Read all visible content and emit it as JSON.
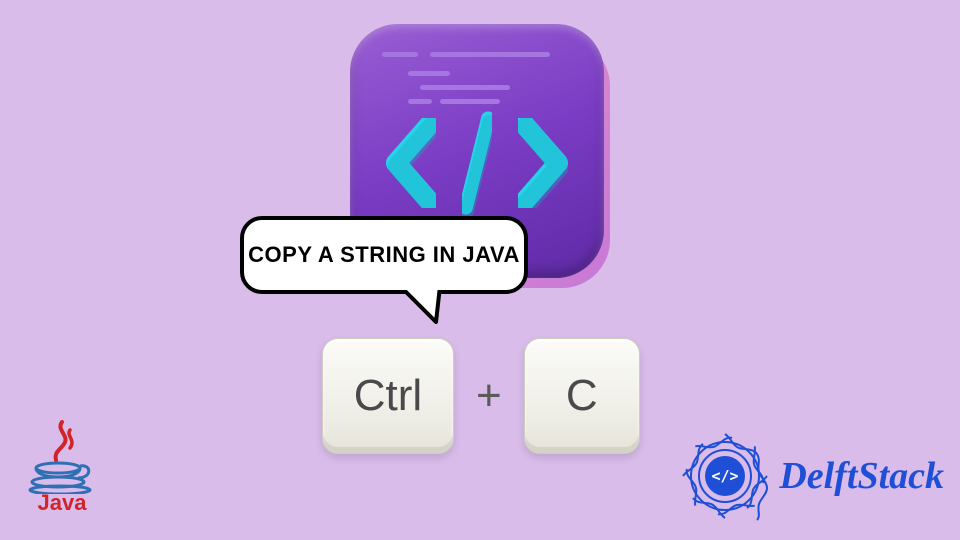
{
  "speech": {
    "text": "COPY A STRING IN JAVA"
  },
  "keys": {
    "ctrl": "Ctrl",
    "plus": "+",
    "c": "C"
  },
  "java": {
    "label": "Java"
  },
  "delft": {
    "label": "DelftStack"
  },
  "icons": {
    "code": "code-brackets-icon",
    "java": "java-cup-icon",
    "delft": "delft-badge-icon"
  },
  "colors": {
    "bg": "#d9bcea",
    "brackets": "#27d3e8",
    "delft_blue": "#1f4fd6",
    "java_red": "#d0242a"
  }
}
